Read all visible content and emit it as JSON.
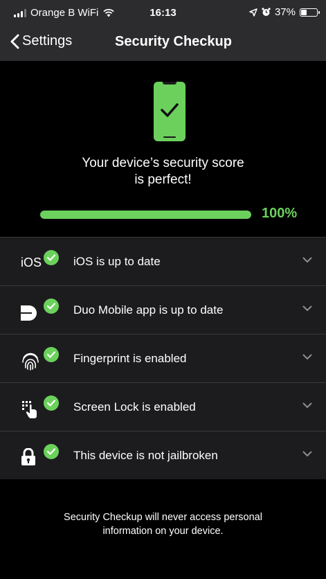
{
  "status_bar": {
    "carrier": "Orange B WiFi",
    "time": "16:13",
    "battery": "37%",
    "battery_level": 0.37
  },
  "nav": {
    "back_label": "Settings",
    "title": "Security Checkup"
  },
  "hero": {
    "score_line1": "Your device’s security score",
    "score_line2": "is perfect!",
    "progress_percent": 100,
    "progress_label": "100%"
  },
  "checks": [
    {
      "icon": "ios-icon",
      "icon_text": "iOS",
      "label": "iOS is up to date"
    },
    {
      "icon": "duo-mobile-icon",
      "label": "Duo Mobile app is up to date"
    },
    {
      "icon": "fingerprint-icon",
      "label": "Fingerprint is enabled"
    },
    {
      "icon": "screen-lock-icon",
      "label": "Screen Lock is enabled"
    },
    {
      "icon": "lock-icon",
      "label": "This device is not jailbroken"
    }
  ],
  "footer": {
    "note_line1": "Security Checkup will never access personal",
    "note_line2": "information on your device."
  },
  "colors": {
    "accent_green": "#6bd15c",
    "row_background": "#1c1c1e",
    "bar_background": "#2c2c2e"
  }
}
